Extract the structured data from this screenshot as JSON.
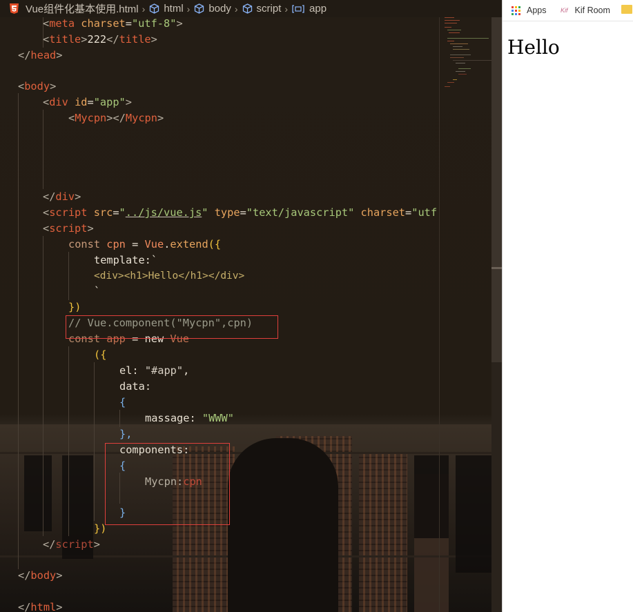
{
  "breadcrumb": {
    "file": "Vue组件化基本使用.html",
    "items": [
      "html",
      "body",
      "script",
      "app"
    ]
  },
  "code": {
    "l1": {
      "lt": "<",
      "tag": "meta",
      "attr": " charset",
      "eq": "=",
      "str": "\"utf-8\"",
      "gt": ">"
    },
    "l2": {
      "lt": "<",
      "tag": "title",
      "gt": ">",
      "text": "222",
      "lt2": "</",
      "tag2": "title",
      "gt2": ">"
    },
    "l3": {
      "lt": "</",
      "tag": "head",
      "gt": ">"
    },
    "l5": {
      "lt": "<",
      "tag": "body",
      "gt": ">"
    },
    "l6": {
      "lt": "<",
      "tag": "div",
      "attr": " id",
      "eq": "=",
      "str": "\"app\"",
      "gt": ">"
    },
    "l7": {
      "lt": "<",
      "tag": "Mycpn",
      "gt": ">",
      "lt2": "</",
      "tag2": "Mycpn",
      "gt2": ">"
    },
    "l12": {
      "lt": "</",
      "tag": "div",
      "gt": ">"
    },
    "l13": {
      "lt": "<",
      "tag": "script",
      "attr": " src",
      "eq": "=",
      "q1": "\"",
      "path": "../js/vue.js",
      "q2": "\"",
      "attr2": " type",
      "eq2": "=",
      "str2": "\"text/javascript\"",
      "attr3": " charset",
      "eq3": "=",
      "str3": "\"utf"
    },
    "l14": {
      "lt": "<",
      "tag": "script",
      "gt": ">"
    },
    "l15": {
      "kw": "const ",
      "var": "cpn",
      "op": " = ",
      "obj": "Vue",
      "dot": ".",
      "fn": "extend",
      "paren": "({"
    },
    "l16": {
      "key": "template:",
      "tick": "`"
    },
    "l17": {
      "html": "<div><h1>Hello</h1></div>"
    },
    "l18": {
      "tick": "`"
    },
    "l19": {
      "close": "})"
    },
    "l20": {
      "comment": "// Vue.component(\"Mycpn\",cpn)"
    },
    "l21": {
      "kw": "const ",
      "var": "app",
      "op": " = ",
      "kw2": "new ",
      "obj": "Vue"
    },
    "l22": {
      "open": "({"
    },
    "l23": {
      "key": "el: ",
      "str": "\"#app\"",
      "comma": ","
    },
    "l24": {
      "key": "data:"
    },
    "l25": {
      "open": "{"
    },
    "l26": {
      "key": "massage: ",
      "str": "\"WWW\""
    },
    "l27": {
      "close": "},"
    },
    "l28": {
      "key": "components:"
    },
    "l29": {
      "open": "{"
    },
    "l30": {
      "key": "Mycpn:",
      "val": "cpn"
    },
    "l32": {
      "close": "}"
    },
    "l33": {
      "close": "})"
    },
    "l34": {
      "lt": "</",
      "tag": "script",
      "gt": ">"
    },
    "l36": {
      "lt": "</",
      "tag": "body",
      "gt": ">"
    },
    "l38": {
      "lt": "</",
      "tag": "html",
      "gt": ">"
    }
  },
  "browser": {
    "bookmarks": [
      {
        "label": "Apps",
        "icon": "apps-grid-icon"
      },
      {
        "label": "Kif Room",
        "icon": "kif-icon"
      }
    ],
    "kif_icon_text": "Kif",
    "page_heading": "Hello"
  },
  "colors": {
    "tag": "#e0613d",
    "string": "#a8c87a",
    "attribute": "#e8a55e",
    "highlight_box": "#e0403c",
    "apps_grid": [
      "#e94235",
      "#fbbc05",
      "#34a853",
      "#4285f4"
    ]
  }
}
